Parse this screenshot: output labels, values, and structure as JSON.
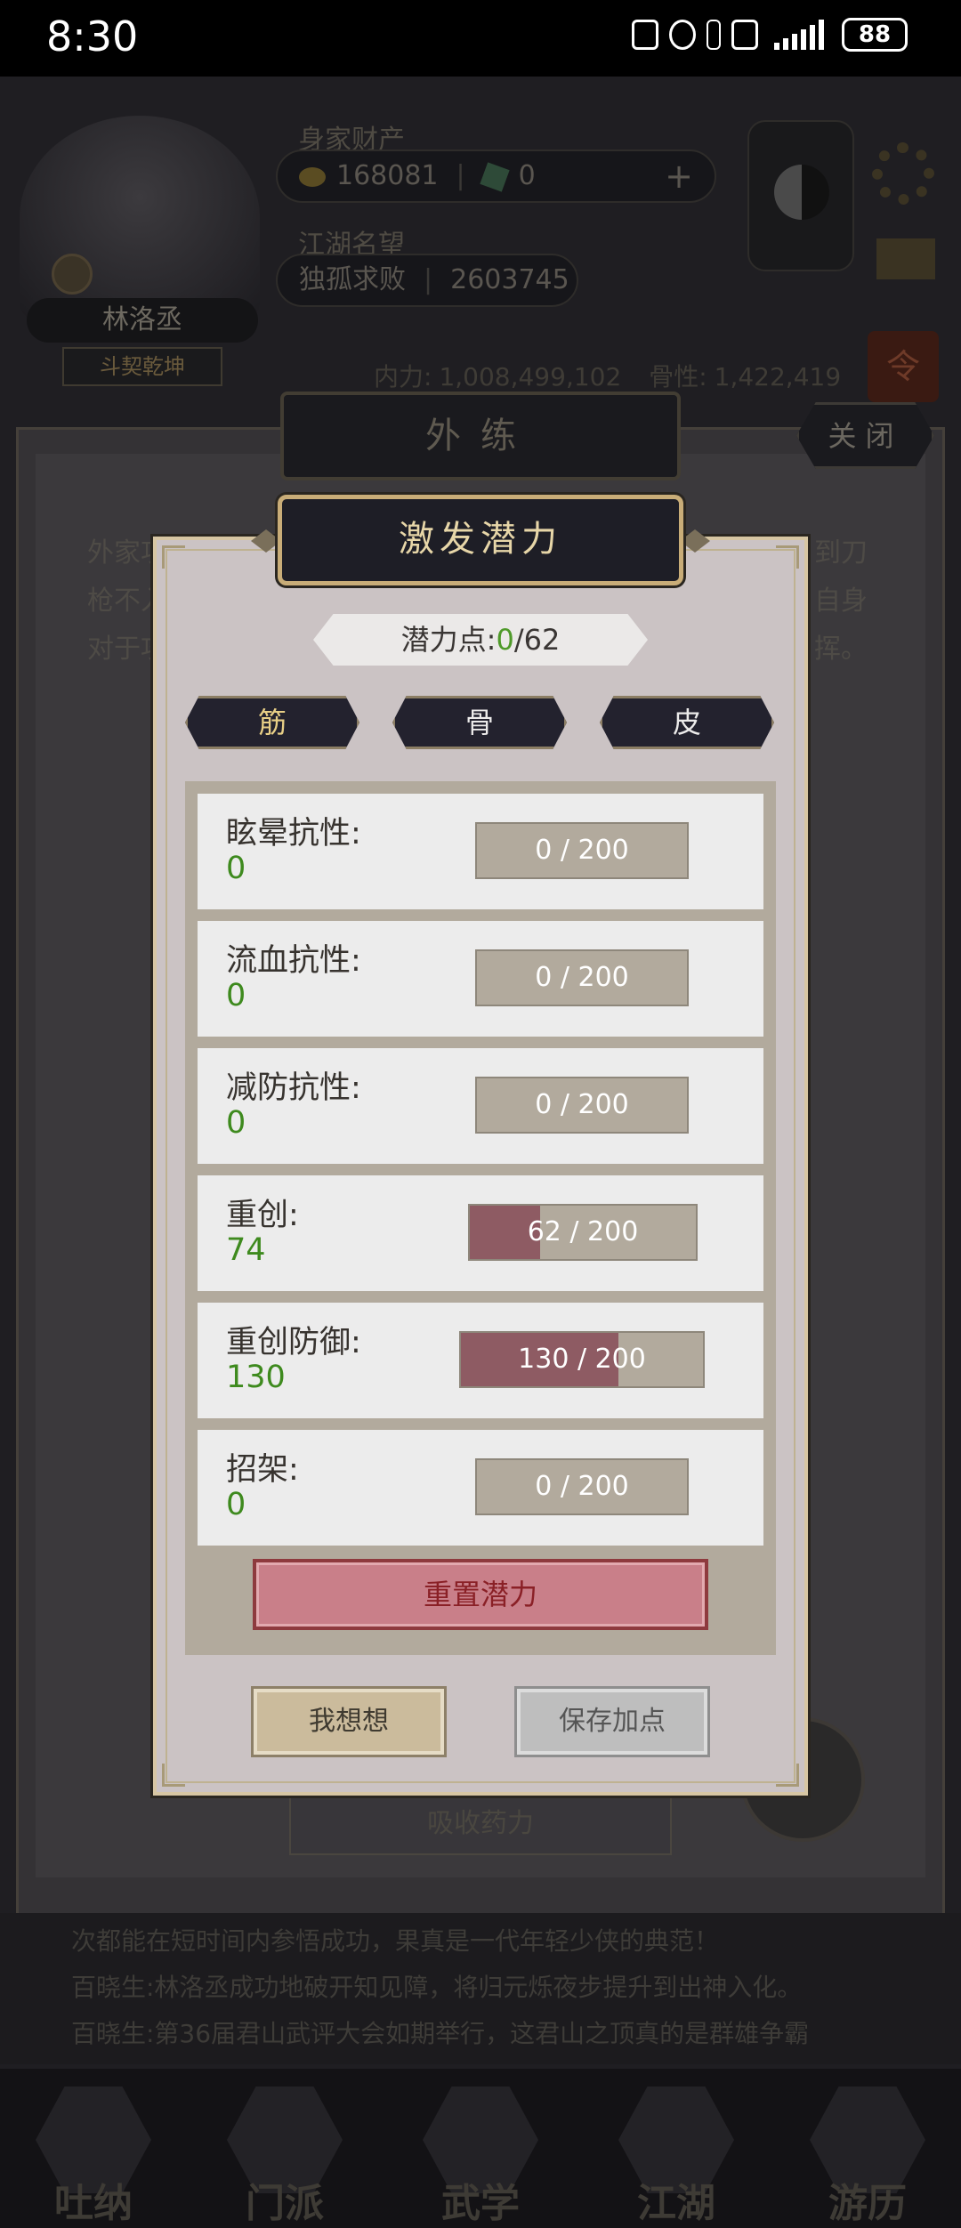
{
  "status_bar": {
    "time": "8:30",
    "battery": "88"
  },
  "header": {
    "assets_label": "身家财产",
    "coins": "168081",
    "gems": "0",
    "add_symbol": "+",
    "fame_label": "江湖名望",
    "rank_title": "独孤求败",
    "fame_value": "2603745",
    "player_name": "林洛丞",
    "player_title": "斗契乾坤",
    "neili_label": "内力:",
    "neili_value": "1,008,499,102",
    "gengu_label": "骨性:",
    "gengu_value": "1,422,419",
    "ling_badge": "令"
  },
  "background_panel": {
    "title": "外练",
    "close_label": "关闭",
    "text_lines": [
      "外家功",
      "枪不入",
      "对于攻"
    ],
    "text_lines_right": [
      "到刀",
      "自身",
      "挥。"
    ],
    "absorb_label": "吸收药力"
  },
  "chat": {
    "lines": [
      "次都能在短时间内参悟成功，果真是一代年轻少侠的典范！",
      "百晓生:林洛丞成功地破开知见障，将归元烁夜步提升到出神入化。",
      "百晓生:第36届君山武评大会如期举行，这君山之顶真的是群雄争霸"
    ]
  },
  "bottom_nav": {
    "items": [
      {
        "label": "吐纳"
      },
      {
        "label": "门派"
      },
      {
        "label": "武学"
      },
      {
        "label": "江湖"
      },
      {
        "label": "游历"
      }
    ]
  },
  "modal": {
    "title": "激发潜力",
    "points_label": "潜力点:",
    "points_used": "0",
    "points_total": "/62",
    "tabs": [
      {
        "label": "筋",
        "active": true
      },
      {
        "label": "骨",
        "active": false
      },
      {
        "label": "皮",
        "active": false
      }
    ],
    "rows": [
      {
        "label": "眩晕抗性:",
        "value": "0",
        "bar_text": "0 / 200",
        "fill": 0.0
      },
      {
        "label": "流血抗性:",
        "value": "0",
        "bar_text": "0 / 200",
        "fill": 0.0
      },
      {
        "label": "减防抗性:",
        "value": "0",
        "bar_text": "0 / 200",
        "fill": 0.0
      },
      {
        "label": "重创:",
        "value": "74",
        "bar_text": "62 / 200",
        "fill": 0.31
      },
      {
        "label": "重创防御:",
        "value": "130",
        "bar_text": "130 / 200",
        "fill": 0.65
      },
      {
        "label": "招架:",
        "value": "0",
        "bar_text": "0 / 200",
        "fill": 0.0
      }
    ],
    "reset_label": "重置潜力",
    "think_label": "我想想",
    "save_label": "保存加点"
  },
  "colors": {
    "value_green": "#3e8a1e",
    "bar_fill": "#8e5b63",
    "reset_bg": "#c97f89",
    "title_gold": "#e7d6a8"
  }
}
